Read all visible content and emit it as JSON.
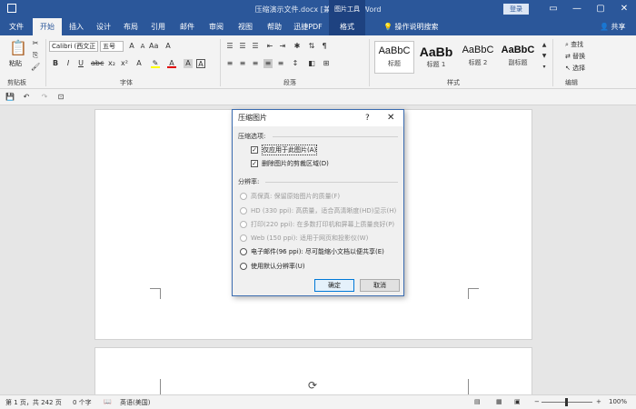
{
  "titlebar": {
    "title": "压缩演示文件.docx [兼容模式] - Word",
    "context_group": "图片工具",
    "login": "登录",
    "minimize": "—",
    "restore": "▢",
    "close": "✕"
  },
  "tabs": [
    {
      "label": "文件"
    },
    {
      "label": "开始"
    },
    {
      "label": "插入"
    },
    {
      "label": "设计"
    },
    {
      "label": "布局"
    },
    {
      "label": "引用"
    },
    {
      "label": "邮件"
    },
    {
      "label": "审阅"
    },
    {
      "label": "视图"
    },
    {
      "label": "帮助"
    },
    {
      "label": "迅捷PDF"
    },
    {
      "label": "格式"
    }
  ],
  "tell_me": "操作说明搜索",
  "share": "共享",
  "ribbon": {
    "clipboard": {
      "paste": "粘贴",
      "label": "剪贴板"
    },
    "font": {
      "name": "Calibri (西文正",
      "size": "五号",
      "label": "字体"
    },
    "paragraph": {
      "label": "段落"
    },
    "styles": {
      "label": "样式",
      "items": [
        {
          "sample": "AaBbC",
          "name": "标题"
        },
        {
          "sample": "AaBb",
          "name": "标题 1"
        },
        {
          "sample": "AaBbC",
          "name": "标题 2"
        },
        {
          "sample": "AaBbC",
          "name": "副标题"
        }
      ]
    },
    "editing": {
      "find": "查找",
      "replace": "替换",
      "select": "选择",
      "label": "编辑"
    }
  },
  "dialog": {
    "title": "压缩图片",
    "help": "?",
    "close": "✕",
    "compress_section": "压缩选项:",
    "checkboxes": [
      {
        "label": "仅应用于此图片(A)",
        "checked": true
      },
      {
        "label": "删除图片的剪裁区域(D)",
        "checked": true
      }
    ],
    "resolution_section": "分辨率:",
    "options": [
      {
        "label": "高保真: 保留原始图片的质量(F)",
        "disabled": true
      },
      {
        "label": "HD (330 ppi): 高质量，适合高清晰度(HD)显示(H)",
        "disabled": true
      },
      {
        "label": "打印(220 ppi): 在多数打印机和屏幕上质量良好(P)",
        "disabled": true
      },
      {
        "label": "Web (150 ppi): 适用于网页和投影仪(W)",
        "disabled": true
      },
      {
        "label": "电子邮件(96 ppi): 尽可能缩小文档以便共享(E)",
        "disabled": false
      },
      {
        "label": "使用默认分辨率(U)",
        "disabled": false
      }
    ],
    "ok": "确定",
    "cancel": "取消"
  },
  "statusbar": {
    "page": "第 1 页，共 242 页",
    "words": "0 个字",
    "language": "英语(美国)",
    "zoom": "100%"
  }
}
